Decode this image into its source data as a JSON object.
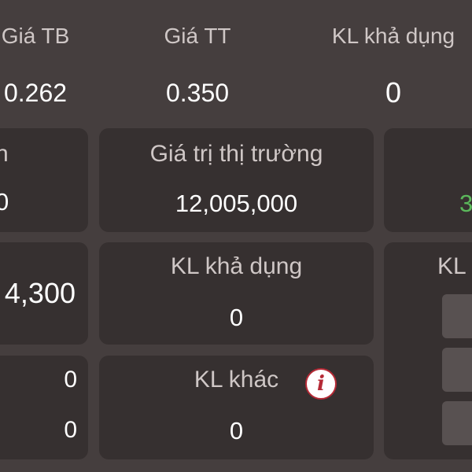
{
  "summary": {
    "avg_price_label": "Giá TB",
    "avg_price_value": "0.262",
    "market_price_label": "Giá TT",
    "market_price_value": "0.350",
    "available_qty_label": "KL khả dụng",
    "available_qty_value": "0"
  },
  "row1": {
    "left_fragment": "n",
    "left_value_fragment": "0",
    "market_value_label": "Giá trị thị trường",
    "market_value_value": "12,005,000",
    "right_value_fragment": "3",
    "right_value_color": "#5bb85b"
  },
  "row2": {
    "left_value_fragment": "4,300",
    "available_qty_label": "KL khả dụng",
    "available_qty_value": "0",
    "right_label_fragment": "KL"
  },
  "row3": {
    "left_value_1": "0",
    "left_value_2": "0",
    "other_qty_label": "KL khác",
    "other_qty_value": "0",
    "info_icon": "info-icon",
    "info_glyph": "i"
  }
}
